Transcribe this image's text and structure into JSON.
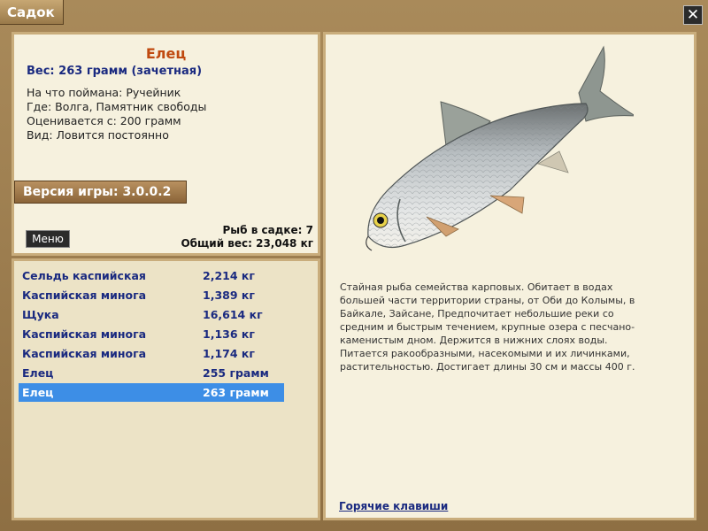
{
  "window": {
    "title": "Садок",
    "close_symbol": "✕"
  },
  "info": {
    "fish_name": "Елец",
    "weight_line": "Вес: 263 грамм (зачетная)",
    "lines": [
      "На что поймана: Ручейник",
      "Где: Волга, Памятник свободы",
      "Оценивается с: 200 грамм",
      "Вид: Ловится постоянно"
    ],
    "version": "Версия игры: 3.0.0.2",
    "menu_label": "Меню",
    "fish_count": "Рыб в садке: 7",
    "total_weight": "Общий вес: 23,048 кг"
  },
  "catch_list": [
    {
      "name": "Сельдь каспийская",
      "weight": "2,214 кг"
    },
    {
      "name": "Каспийская минога",
      "weight": "1,389 кг"
    },
    {
      "name": "Щука",
      "weight": "16,614 кг"
    },
    {
      "name": "Каспийская минога",
      "weight": "1,136 кг"
    },
    {
      "name": "Каспийская минога",
      "weight": "1,174 кг"
    },
    {
      "name": "Елец",
      "weight": "255 грамм"
    },
    {
      "name": "Елец",
      "weight": "263 грамм"
    }
  ],
  "selected_index": 6,
  "detail": {
    "description": "Стайная рыба семейства карповых. Обитает в водах большей части территории страны, от Оби до Колымы, в Байкале, Зайсане, Предпочитает небольшие реки со средним и быстрым течением, крупные озера с песчано-каменистым дном. Держится в нижних слоях воды. Питается ракообразными, насекомыми и их личинками, растительностью. Достигает длины 30 см и массы 400 г.",
    "hotkeys_link": "Горячие клавиши"
  },
  "colors": {
    "frame": "#9c7d4f",
    "panel": "#f6f1de",
    "title_accent": "#c04a10",
    "text_blue": "#1a2a80",
    "selection": "#3d8ee6"
  }
}
